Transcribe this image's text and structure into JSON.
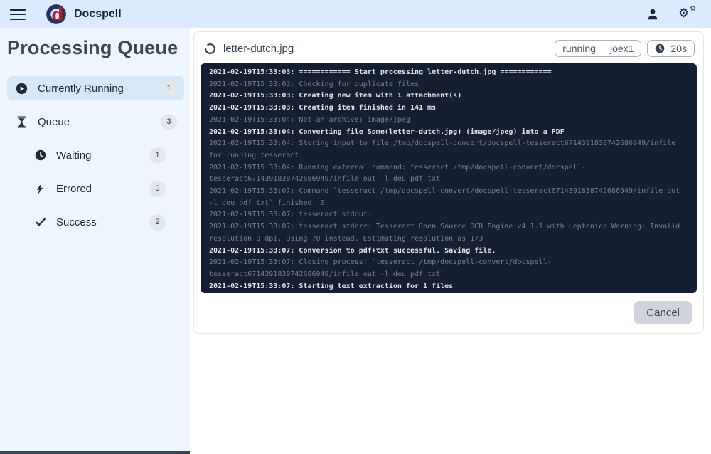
{
  "navbar": {
    "app_title": "Docspell"
  },
  "sidebar": {
    "title": "Processing Queue",
    "items": [
      {
        "label": "Currently Running",
        "count": "1",
        "icon": "play-circle",
        "active": true,
        "indent": false
      },
      {
        "label": "Queue",
        "count": "3",
        "icon": "hourglass",
        "active": false,
        "indent": false
      },
      {
        "label": "Waiting",
        "count": "1",
        "icon": "clock",
        "active": false,
        "indent": true
      },
      {
        "label": "Errored",
        "count": "0",
        "icon": "bolt",
        "active": false,
        "indent": true
      },
      {
        "label": "Success",
        "count": "2",
        "icon": "check",
        "active": false,
        "indent": true
      }
    ]
  },
  "job_card": {
    "file_name": "letter-dutch.jpg",
    "state_badge": {
      "state": "running",
      "worker": "joex1"
    },
    "duration": "20s",
    "cancel_label": "Cancel"
  },
  "console": {
    "lines": [
      {
        "level": "info",
        "text": "2021-02-19T15:33:03: ============ Start processing letter-dutch.jpg ============"
      },
      {
        "level": "debug",
        "text": "2021-02-19T15:33:03: Checking for duplicate files"
      },
      {
        "level": "info",
        "text": "2021-02-19T15:33:03: Creating new item with 1 attachment(s)"
      },
      {
        "level": "info",
        "text": "2021-02-19T15:33:03: Creating item finished in 141 ms"
      },
      {
        "level": "debug",
        "text": "2021-02-19T15:33:04: Not an archive: image/jpeg"
      },
      {
        "level": "info",
        "text": "2021-02-19T15:33:04: Converting file Some(letter-dutch.jpg) (image/jpeg) into a PDF"
      },
      {
        "level": "debug",
        "text": "2021-02-19T15:33:04: Storing input to file /tmp/docspell-convert/docspell-tesseract6714391838742686949/infile for running tesseract"
      },
      {
        "level": "debug",
        "text": "2021-02-19T15:33:04: Running external command: tesseract /tmp/docspell-convert/docspell-tesseract6714391838742686949/infile out -l deu pdf txt"
      },
      {
        "level": "debug",
        "text": "2021-02-19T15:33:07: Command `tesseract /tmp/docspell-convert/docspell-tesseract6714391838742686949/infile out -l deu pdf txt` finished: 0"
      },
      {
        "level": "debug",
        "text": "2021-02-19T15:33:07: tesseract stdout: "
      },
      {
        "level": "debug",
        "text": "2021-02-19T15:33:07: tesseract stderr: Tesseract Open Source OCR Engine v4.1.1 with Leptonica Warning: Invalid resolution 0 dpi. Using 70 instead. Estimating resolution as 173"
      },
      {
        "level": "info",
        "text": "2021-02-19T15:33:07: Conversion to pdf+txt successful. Saving file."
      },
      {
        "level": "debug",
        "text": "2021-02-19T15:33:07: Closing process: `tesseract /tmp/docspell-convert/docspell-tesseract6714391838742686949/infile out -l deu pdf txt`"
      },
      {
        "level": "info",
        "text": "2021-02-19T15:33:07: Starting text extraction for 1 files"
      }
    ]
  },
  "colors": {
    "navbar_bg": "#dbeafe",
    "sidebar_bg": "#eef5fd",
    "active_item_bg": "#d6e7f8",
    "brand_navy": "#1a2440",
    "brand_red": "#bf1b1b",
    "console_bg": "#161e32",
    "log_bright": "#dfe4ec",
    "log_dim": "#747f96"
  }
}
